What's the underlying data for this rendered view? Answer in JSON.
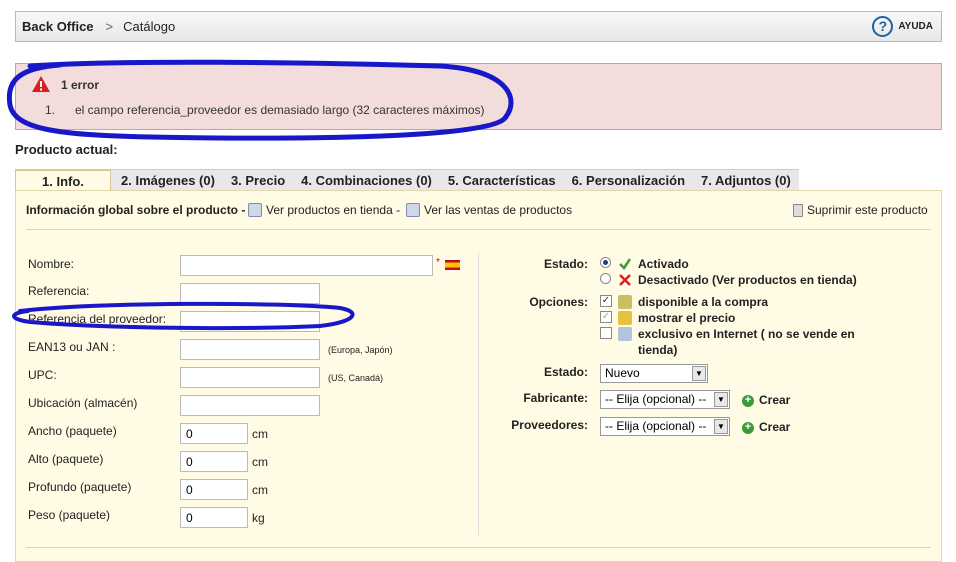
{
  "header": {
    "crumb_root": "Back Office",
    "crumb_separator": ">",
    "crumb_current": "Catálogo",
    "help_label": "AYUDA"
  },
  "error": {
    "title": "1 error",
    "index": "1.",
    "message": "el campo referencia_proveedor es demasiado largo (32 caracteres máximos)"
  },
  "product_label": "Producto actual:",
  "tabs": [
    "1. Info.",
    "2. Imágenes (0)",
    "3. Precio",
    "4. Combinaciones (0)",
    "5. Características",
    "6. Personalización",
    "7. Adjuntos (0)"
  ],
  "panel": {
    "title": "Información global sobre el producto -",
    "link_view": "Ver productos en tienda -",
    "link_sales": "Ver las ventas de productos",
    "delete": "Suprimir este producto"
  },
  "form": {
    "nombre": "Nombre:",
    "nombre_req": "*",
    "referencia": "Referencia:",
    "ref_prov": "Referencia del proveedor:",
    "ean": "EAN13 ou JAN :",
    "ean_hint": "(Europa, Japón)",
    "upc": "UPC:",
    "upc_hint": "(US, Canadá)",
    "ubic": "Ubicación (almacén)",
    "ancho": "Ancho (paquete)",
    "ancho_val": "0",
    "ancho_unit": "cm",
    "alto": "Alto (paquete)",
    "alto_val": "0",
    "alto_unit": "cm",
    "prof": "Profundo (paquete)",
    "prof_val": "0",
    "prof_unit": "cm",
    "peso": "Peso (paquete)",
    "peso_val": "0",
    "peso_unit": "kg"
  },
  "right": {
    "estado": "Estado:",
    "activado": "Activado",
    "desactivado": "Desactivado (Ver productos en tienda)",
    "opciones": "Opciones:",
    "opt1": "disponible a la compra",
    "opt2": "mostrar el precio",
    "opt3a": "exclusivo en Internet ( no se vende en",
    "opt3b": "tienda)",
    "estado2": "Estado:",
    "estado2_val": "Nuevo",
    "fabricante": "Fabricante:",
    "fabricante_val": "-- Elija (opcional) --",
    "crear1": "Crear",
    "proveedores": "Proveedores:",
    "proveedores_val": "-- Elija (opcional) --",
    "crear2": "Crear"
  },
  "colors": {
    "error_bg": "#f3dcdc",
    "panel_bg": "#fffbe5",
    "scribble": "#1818c8"
  }
}
